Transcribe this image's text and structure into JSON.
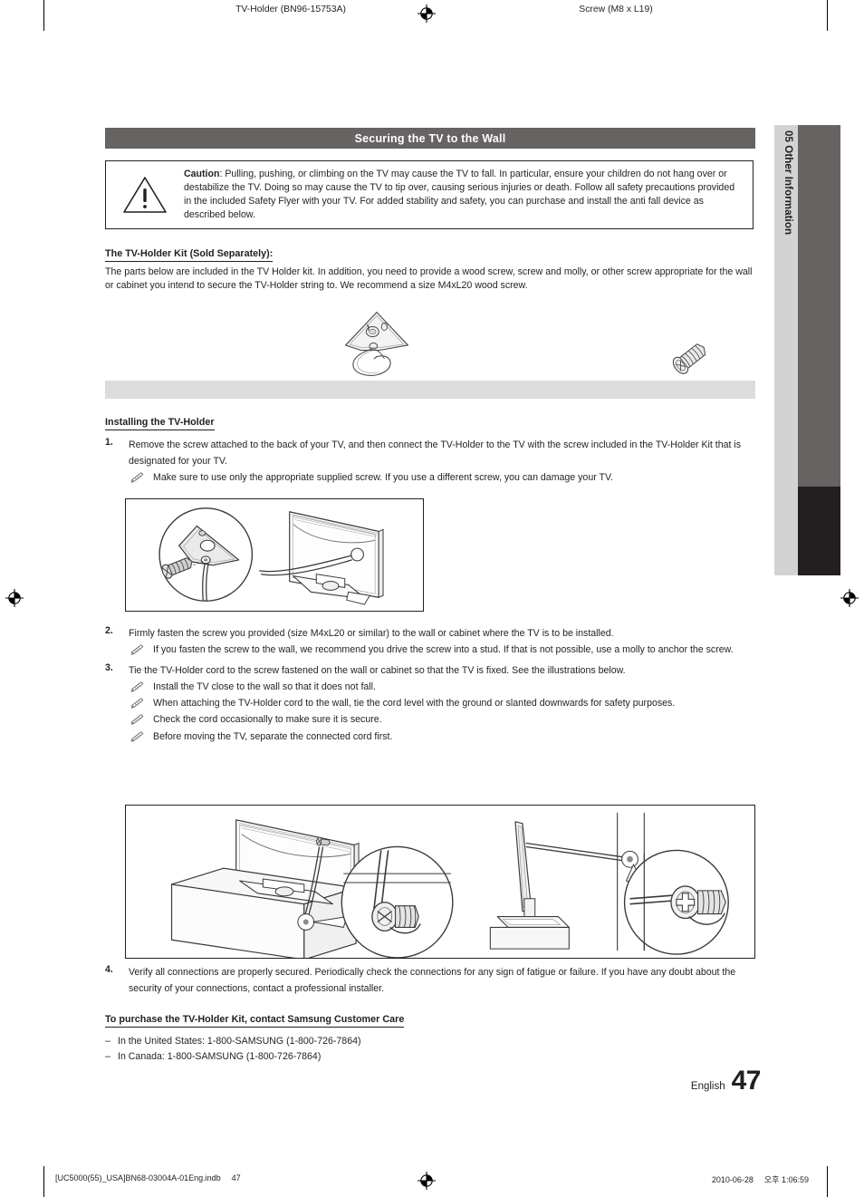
{
  "chapter_tab": {
    "number": "05",
    "label": "Other Information",
    "combined": "05  Other Information"
  },
  "section": {
    "title": "Securing the TV to the Wall"
  },
  "caution": {
    "icon": "warning-triangle-icon",
    "lead": "Caution",
    "text": ": Pulling, pushing, or climbing on the TV may cause the TV to fall. In particular, ensure your children do not hang over or destabilize the TV. Doing so may cause the TV to tip over, causing serious injuries or death. Follow all safety precautions provided in the included Safety Flyer with your TV. For added stability and safety, you can purchase and install the anti fall device as described below."
  },
  "kit": {
    "heading": "The TV-Holder Kit (Sold Separately):",
    "body": "The parts below are included in the TV Holder kit. In addition, you need to provide a wood screw, screw and molly, or other screw appropriate for the wall or cabinet you intend to secure the TV-Holder string to. We recommend a size M4xL20 wood screw.",
    "parts": [
      {
        "caption": "TV-Holder  (BN96-15753A)",
        "icon": "tv-holder-bracket-icon"
      },
      {
        "caption": "Screw (M8 x L19)",
        "icon": "screw-icon"
      }
    ]
  },
  "install": {
    "heading": "Installing the TV-Holder",
    "steps": [
      {
        "number": "1.",
        "text": "Remove the screw attached to the back of your TV, and then connect the TV-Holder to the TV with the screw included in the TV-Holder Kit that is designated for your TV.",
        "notes": [
          "Make sure to use only the appropriate supplied screw. If you use a different screw, you can damage your TV."
        ]
      },
      {
        "number": "2.",
        "text": "Firmly fasten the screw you provided (size M4xL20 or similar) to the wall or cabinet where the TV is to be installed.",
        "notes": [
          "If you fasten the screw to the wall, we recommend you drive the screw into a stud. If that is not possible, use a molly to anchor the screw."
        ]
      },
      {
        "number": "3.",
        "text": "Tie the TV-Holder cord to the screw fastened on the wall or cabinet so that the TV is fixed. See the illustrations below.",
        "notes": [
          "Install the TV close to the wall so that it does not fall.",
          "When attaching the TV-Holder cord to the wall, tie the cord level with the ground or slanted downwards for safety purposes.",
          "Check the cord occasionally to make sure it is secure.",
          "Before moving the TV, separate the connected cord first."
        ]
      },
      {
        "number": "4.",
        "text": "Verify all connections are properly secured. Periodically check the connections for any sign of fatigue or failure. If you have any doubt about the security of your connections, contact a professional installer.",
        "notes": []
      }
    ],
    "figure_1_alt": "TV rear view with magnified detail of TV-Holder bracket attached by screw",
    "figure_2_left_alt": "TV on cabinet with holder cord tied to screw in cabinet, magnified detail",
    "figure_2_right_alt": "TV side view tethered to wall screw, magnified detail"
  },
  "purchase": {
    "heading": "To purchase the TV-Holder Kit, contact Samsung Customer Care",
    "lines": [
      {
        "dash": "–",
        "text": "In the United States: 1-800-SAMSUNG (1-800-726-7864)"
      },
      {
        "dash": "–",
        "text": "In Canada: 1-800-SAMSUNG (1-800-726-7864)"
      }
    ]
  },
  "folio": {
    "language": "English",
    "page_number": "47"
  },
  "footer": {
    "file": "[UC5000(55)_USA]BN68-03004A-01Eng.indb",
    "page": "47",
    "date": "2010-06-28",
    "time": "오후 1:06:59"
  },
  "colors": {
    "header_bar": "#666362",
    "tab_light": "#d3d3d3",
    "tab_dark": "#231f20",
    "caption_bar": "#dcdcdc",
    "text": "#231f20"
  }
}
